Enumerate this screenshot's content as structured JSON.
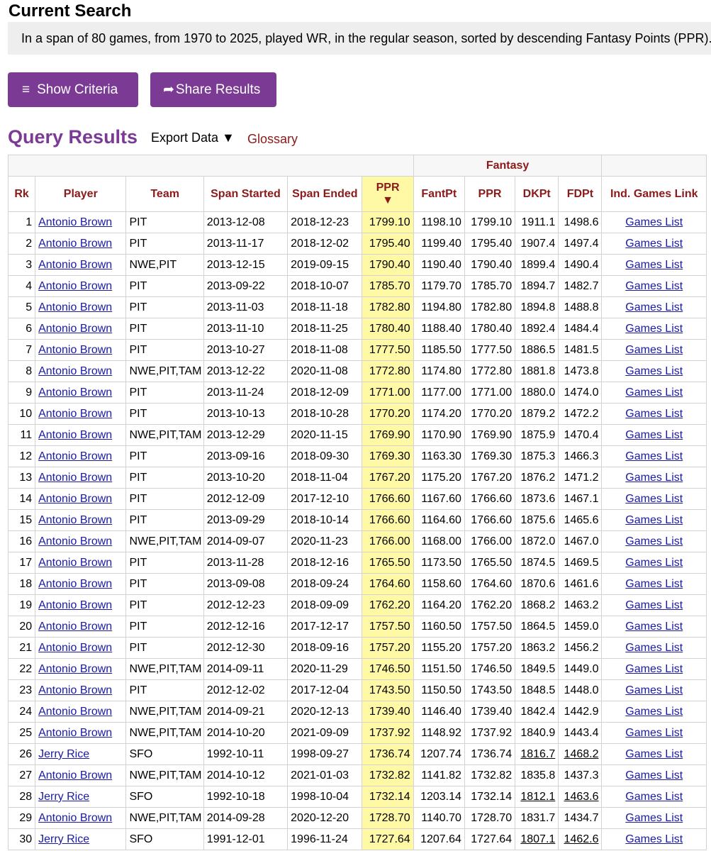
{
  "header": {
    "current_search_title": "Current Search",
    "criteria_text": "In a span of 80 games, from 1970 to 2025, played WR, in the regular season, sorted by descending Fantasy Points (PPR).",
    "show_criteria_label": "Show Criteria",
    "share_results_label": "Share Results",
    "menu_icon": "≡",
    "share_icon": "➦"
  },
  "results": {
    "title": "Query Results",
    "export_label": "Export Data ▼",
    "glossary_label": "Glossary"
  },
  "table": {
    "group_header": "Fantasy",
    "columns": [
      "Rk",
      "Player",
      "Team",
      "Span Started",
      "Span Ended",
      "PPR",
      "FantPt",
      "PPR",
      "DKPt",
      "FDPt",
      "Ind. Games Link"
    ],
    "sort_arrow": "▼",
    "rows": [
      {
        "rk": "1",
        "player": "Antonio Brown",
        "team": "PIT",
        "start": "2013-12-08",
        "end": "2018-12-23",
        "ppr": "1799.10",
        "fantpt": "1198.10",
        "ppr2": "1799.10",
        "dk": "1911.1",
        "fd": "1498.6",
        "link": "Games List"
      },
      {
        "rk": "2",
        "player": "Antonio Brown",
        "team": "PIT",
        "start": "2013-11-17",
        "end": "2018-12-02",
        "ppr": "1795.40",
        "fantpt": "1199.40",
        "ppr2": "1795.40",
        "dk": "1907.4",
        "fd": "1497.4",
        "link": "Games List"
      },
      {
        "rk": "3",
        "player": "Antonio Brown",
        "team": "NWE,PIT",
        "start": "2013-12-15",
        "end": "2019-09-15",
        "ppr": "1790.40",
        "fantpt": "1190.40",
        "ppr2": "1790.40",
        "dk": "1899.4",
        "fd": "1490.4",
        "link": "Games List"
      },
      {
        "rk": "4",
        "player": "Antonio Brown",
        "team": "PIT",
        "start": "2013-09-22",
        "end": "2018-10-07",
        "ppr": "1785.70",
        "fantpt": "1179.70",
        "ppr2": "1785.70",
        "dk": "1894.7",
        "fd": "1482.7",
        "link": "Games List"
      },
      {
        "rk": "5",
        "player": "Antonio Brown",
        "team": "PIT",
        "start": "2013-11-03",
        "end": "2018-11-18",
        "ppr": "1782.80",
        "fantpt": "1194.80",
        "ppr2": "1782.80",
        "dk": "1894.8",
        "fd": "1488.8",
        "link": "Games List"
      },
      {
        "rk": "6",
        "player": "Antonio Brown",
        "team": "PIT",
        "start": "2013-11-10",
        "end": "2018-11-25",
        "ppr": "1780.40",
        "fantpt": "1188.40",
        "ppr2": "1780.40",
        "dk": "1892.4",
        "fd": "1484.4",
        "link": "Games List"
      },
      {
        "rk": "7",
        "player": "Antonio Brown",
        "team": "PIT",
        "start": "2013-10-27",
        "end": "2018-11-08",
        "ppr": "1777.50",
        "fantpt": "1185.50",
        "ppr2": "1777.50",
        "dk": "1886.5",
        "fd": "1481.5",
        "link": "Games List"
      },
      {
        "rk": "8",
        "player": "Antonio Brown",
        "team": "NWE,PIT,TAM",
        "start": "2013-12-22",
        "end": "2020-11-08",
        "ppr": "1772.80",
        "fantpt": "1174.80",
        "ppr2": "1772.80",
        "dk": "1881.8",
        "fd": "1473.8",
        "link": "Games List"
      },
      {
        "rk": "9",
        "player": "Antonio Brown",
        "team": "PIT",
        "start": "2013-11-24",
        "end": "2018-12-09",
        "ppr": "1771.00",
        "fantpt": "1177.00",
        "ppr2": "1771.00",
        "dk": "1880.0",
        "fd": "1474.0",
        "link": "Games List"
      },
      {
        "rk": "10",
        "player": "Antonio Brown",
        "team": "PIT",
        "start": "2013-10-13",
        "end": "2018-10-28",
        "ppr": "1770.20",
        "fantpt": "1174.20",
        "ppr2": "1770.20",
        "dk": "1879.2",
        "fd": "1472.2",
        "link": "Games List"
      },
      {
        "rk": "11",
        "player": "Antonio Brown",
        "team": "NWE,PIT,TAM",
        "start": "2013-12-29",
        "end": "2020-11-15",
        "ppr": "1769.90",
        "fantpt": "1170.90",
        "ppr2": "1769.90",
        "dk": "1875.9",
        "fd": "1470.4",
        "link": "Games List"
      },
      {
        "rk": "12",
        "player": "Antonio Brown",
        "team": "PIT",
        "start": "2013-09-16",
        "end": "2018-09-30",
        "ppr": "1769.30",
        "fantpt": "1163.30",
        "ppr2": "1769.30",
        "dk": "1875.3",
        "fd": "1466.3",
        "link": "Games List"
      },
      {
        "rk": "13",
        "player": "Antonio Brown",
        "team": "PIT",
        "start": "2013-10-20",
        "end": "2018-11-04",
        "ppr": "1767.20",
        "fantpt": "1175.20",
        "ppr2": "1767.20",
        "dk": "1876.2",
        "fd": "1471.2",
        "link": "Games List"
      },
      {
        "rk": "14",
        "player": "Antonio Brown",
        "team": "PIT",
        "start": "2012-12-09",
        "end": "2017-12-10",
        "ppr": "1766.60",
        "fantpt": "1167.60",
        "ppr2": "1766.60",
        "dk": "1873.6",
        "fd": "1467.1",
        "link": "Games List"
      },
      {
        "rk": "15",
        "player": "Antonio Brown",
        "team": "PIT",
        "start": "2013-09-29",
        "end": "2018-10-14",
        "ppr": "1766.60",
        "fantpt": "1164.60",
        "ppr2": "1766.60",
        "dk": "1875.6",
        "fd": "1465.6",
        "link": "Games List"
      },
      {
        "rk": "16",
        "player": "Antonio Brown",
        "team": "NWE,PIT,TAM",
        "start": "2014-09-07",
        "end": "2020-11-23",
        "ppr": "1766.00",
        "fantpt": "1168.00",
        "ppr2": "1766.00",
        "dk": "1872.0",
        "fd": "1467.0",
        "link": "Games List"
      },
      {
        "rk": "17",
        "player": "Antonio Brown",
        "team": "PIT",
        "start": "2013-11-28",
        "end": "2018-12-16",
        "ppr": "1765.50",
        "fantpt": "1173.50",
        "ppr2": "1765.50",
        "dk": "1874.5",
        "fd": "1469.5",
        "link": "Games List"
      },
      {
        "rk": "18",
        "player": "Antonio Brown",
        "team": "PIT",
        "start": "2013-09-08",
        "end": "2018-09-24",
        "ppr": "1764.60",
        "fantpt": "1158.60",
        "ppr2": "1764.60",
        "dk": "1870.6",
        "fd": "1461.6",
        "link": "Games List"
      },
      {
        "rk": "19",
        "player": "Antonio Brown",
        "team": "PIT",
        "start": "2012-12-23",
        "end": "2018-09-09",
        "ppr": "1762.20",
        "fantpt": "1164.20",
        "ppr2": "1762.20",
        "dk": "1868.2",
        "fd": "1463.2",
        "link": "Games List"
      },
      {
        "rk": "20",
        "player": "Antonio Brown",
        "team": "PIT",
        "start": "2012-12-16",
        "end": "2017-12-17",
        "ppr": "1757.50",
        "fantpt": "1160.50",
        "ppr2": "1757.50",
        "dk": "1864.5",
        "fd": "1459.0",
        "link": "Games List"
      },
      {
        "rk": "21",
        "player": "Antonio Brown",
        "team": "PIT",
        "start": "2012-12-30",
        "end": "2018-09-16",
        "ppr": "1757.20",
        "fantpt": "1155.20",
        "ppr2": "1757.20",
        "dk": "1863.2",
        "fd": "1456.2",
        "link": "Games List"
      },
      {
        "rk": "22",
        "player": "Antonio Brown",
        "team": "NWE,PIT,TAM",
        "start": "2014-09-11",
        "end": "2020-11-29",
        "ppr": "1746.50",
        "fantpt": "1151.50",
        "ppr2": "1746.50",
        "dk": "1849.5",
        "fd": "1449.0",
        "link": "Games List"
      },
      {
        "rk": "23",
        "player": "Antonio Brown",
        "team": "PIT",
        "start": "2012-12-02",
        "end": "2017-12-04",
        "ppr": "1743.50",
        "fantpt": "1150.50",
        "ppr2": "1743.50",
        "dk": "1848.5",
        "fd": "1448.0",
        "link": "Games List"
      },
      {
        "rk": "24",
        "player": "Antonio Brown",
        "team": "NWE,PIT,TAM",
        "start": "2014-09-21",
        "end": "2020-12-13",
        "ppr": "1739.40",
        "fantpt": "1146.40",
        "ppr2": "1739.40",
        "dk": "1842.4",
        "fd": "1442.9",
        "link": "Games List"
      },
      {
        "rk": "25",
        "player": "Antonio Brown",
        "team": "NWE,PIT,TAM",
        "start": "2014-10-20",
        "end": "2021-09-09",
        "ppr": "1737.92",
        "fantpt": "1148.92",
        "ppr2": "1737.92",
        "dk": "1840.9",
        "fd": "1443.4",
        "link": "Games List"
      },
      {
        "rk": "26",
        "player": "Jerry Rice",
        "team": "SFO",
        "start": "1992-10-11",
        "end": "1998-09-27",
        "ppr": "1736.74",
        "fantpt": "1207.74",
        "ppr2": "1736.74",
        "dk": "1816.7",
        "fd": "1468.2",
        "link": "Games List",
        "ul": true
      },
      {
        "rk": "27",
        "player": "Antonio Brown",
        "team": "NWE,PIT,TAM",
        "start": "2014-10-12",
        "end": "2021-01-03",
        "ppr": "1732.82",
        "fantpt": "1141.82",
        "ppr2": "1732.82",
        "dk": "1835.8",
        "fd": "1437.3",
        "link": "Games List"
      },
      {
        "rk": "28",
        "player": "Jerry Rice",
        "team": "SFO",
        "start": "1992-10-18",
        "end": "1998-10-04",
        "ppr": "1732.14",
        "fantpt": "1203.14",
        "ppr2": "1732.14",
        "dk": "1812.1",
        "fd": "1463.6",
        "link": "Games List",
        "ul": true
      },
      {
        "rk": "29",
        "player": "Antonio Brown",
        "team": "NWE,PIT,TAM",
        "start": "2014-09-28",
        "end": "2020-12-20",
        "ppr": "1728.70",
        "fantpt": "1140.70",
        "ppr2": "1728.70",
        "dk": "1831.7",
        "fd": "1434.7",
        "link": "Games List"
      },
      {
        "rk": "30",
        "player": "Jerry Rice",
        "team": "SFO",
        "start": "1991-12-01",
        "end": "1996-11-24",
        "ppr": "1727.64",
        "fantpt": "1207.64",
        "ppr2": "1727.64",
        "dk": "1807.1",
        "fd": "1462.6",
        "link": "Games List",
        "ul": true
      }
    ]
  },
  "colors": {
    "accent_purple": "#7b3b95",
    "header_red": "#8b1a1a",
    "sorted_highlight": "#fff9a6",
    "link_blue": "#1a1aa6"
  }
}
